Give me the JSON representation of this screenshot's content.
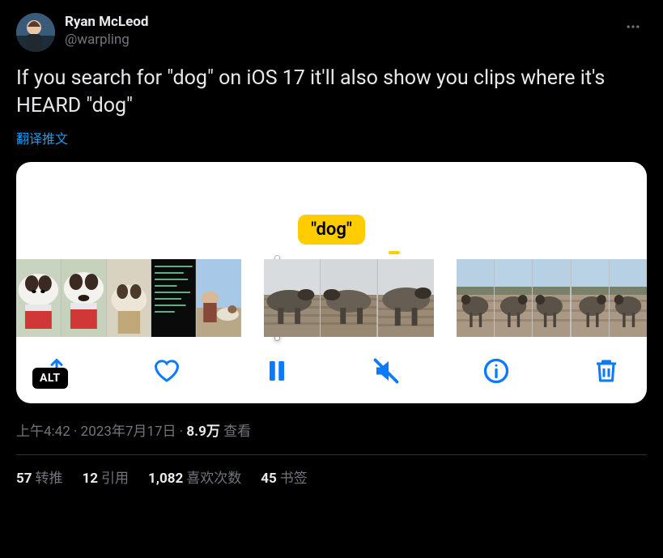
{
  "author": {
    "display_name": "Ryan McLeod",
    "handle": "@warpling"
  },
  "tweet_text": "If you search for \"dog\" on iOS 17 it'll also show you clips where it's HEARD \"dog\"",
  "translate_label": "翻译推文",
  "media": {
    "caption": "\"dog\"",
    "alt_badge": "ALT"
  },
  "meta": {
    "time": "上午4:42",
    "date": "2023年7月17日",
    "views_value": "8.9万",
    "views_label": "查看",
    "separator": " · "
  },
  "stats": {
    "retweets": {
      "value": "57",
      "label": "转推"
    },
    "quotes": {
      "value": "12",
      "label": "引用"
    },
    "likes": {
      "value": "1,082",
      "label": "喜欢次数"
    },
    "bookmarks": {
      "value": "45",
      "label": "书签"
    }
  }
}
